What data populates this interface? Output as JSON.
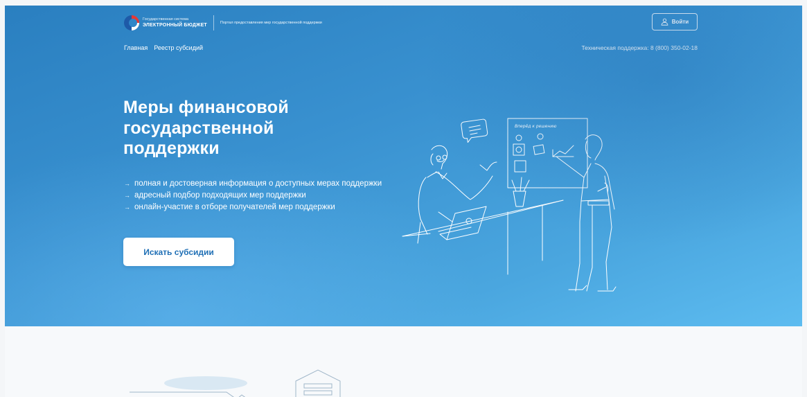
{
  "header": {
    "logo_line1": "Государственная система",
    "logo_line2": "ЭЛЕКТРОННЫЙ БЮДЖЕТ",
    "portal_title": "Портал предоставления мер государственной поддержки",
    "login_label": "Войти",
    "login_icon": "user-icon"
  },
  "nav": {
    "items": [
      "Главная",
      "Реестр субсидий"
    ],
    "support": "Техническая поддержка: 8 (800) 350-02-18"
  },
  "hero": {
    "title": "Меры финансовой государственной поддержки",
    "bullets": [
      "полная и достоверная информация о доступных мерах поддержки",
      "адресный подбор подходящих мер поддержки",
      "онлайн-участие в отборе получателей мер поддержки"
    ],
    "bullet_icon": "arrow-right-icon",
    "cta_label": "Искать субсидии",
    "board_caption": "Вперёд к решению"
  },
  "colors": {
    "hero_start": "#2a7fc0",
    "hero_end": "#5dbcf0",
    "cta_text": "#1f6fb5"
  }
}
